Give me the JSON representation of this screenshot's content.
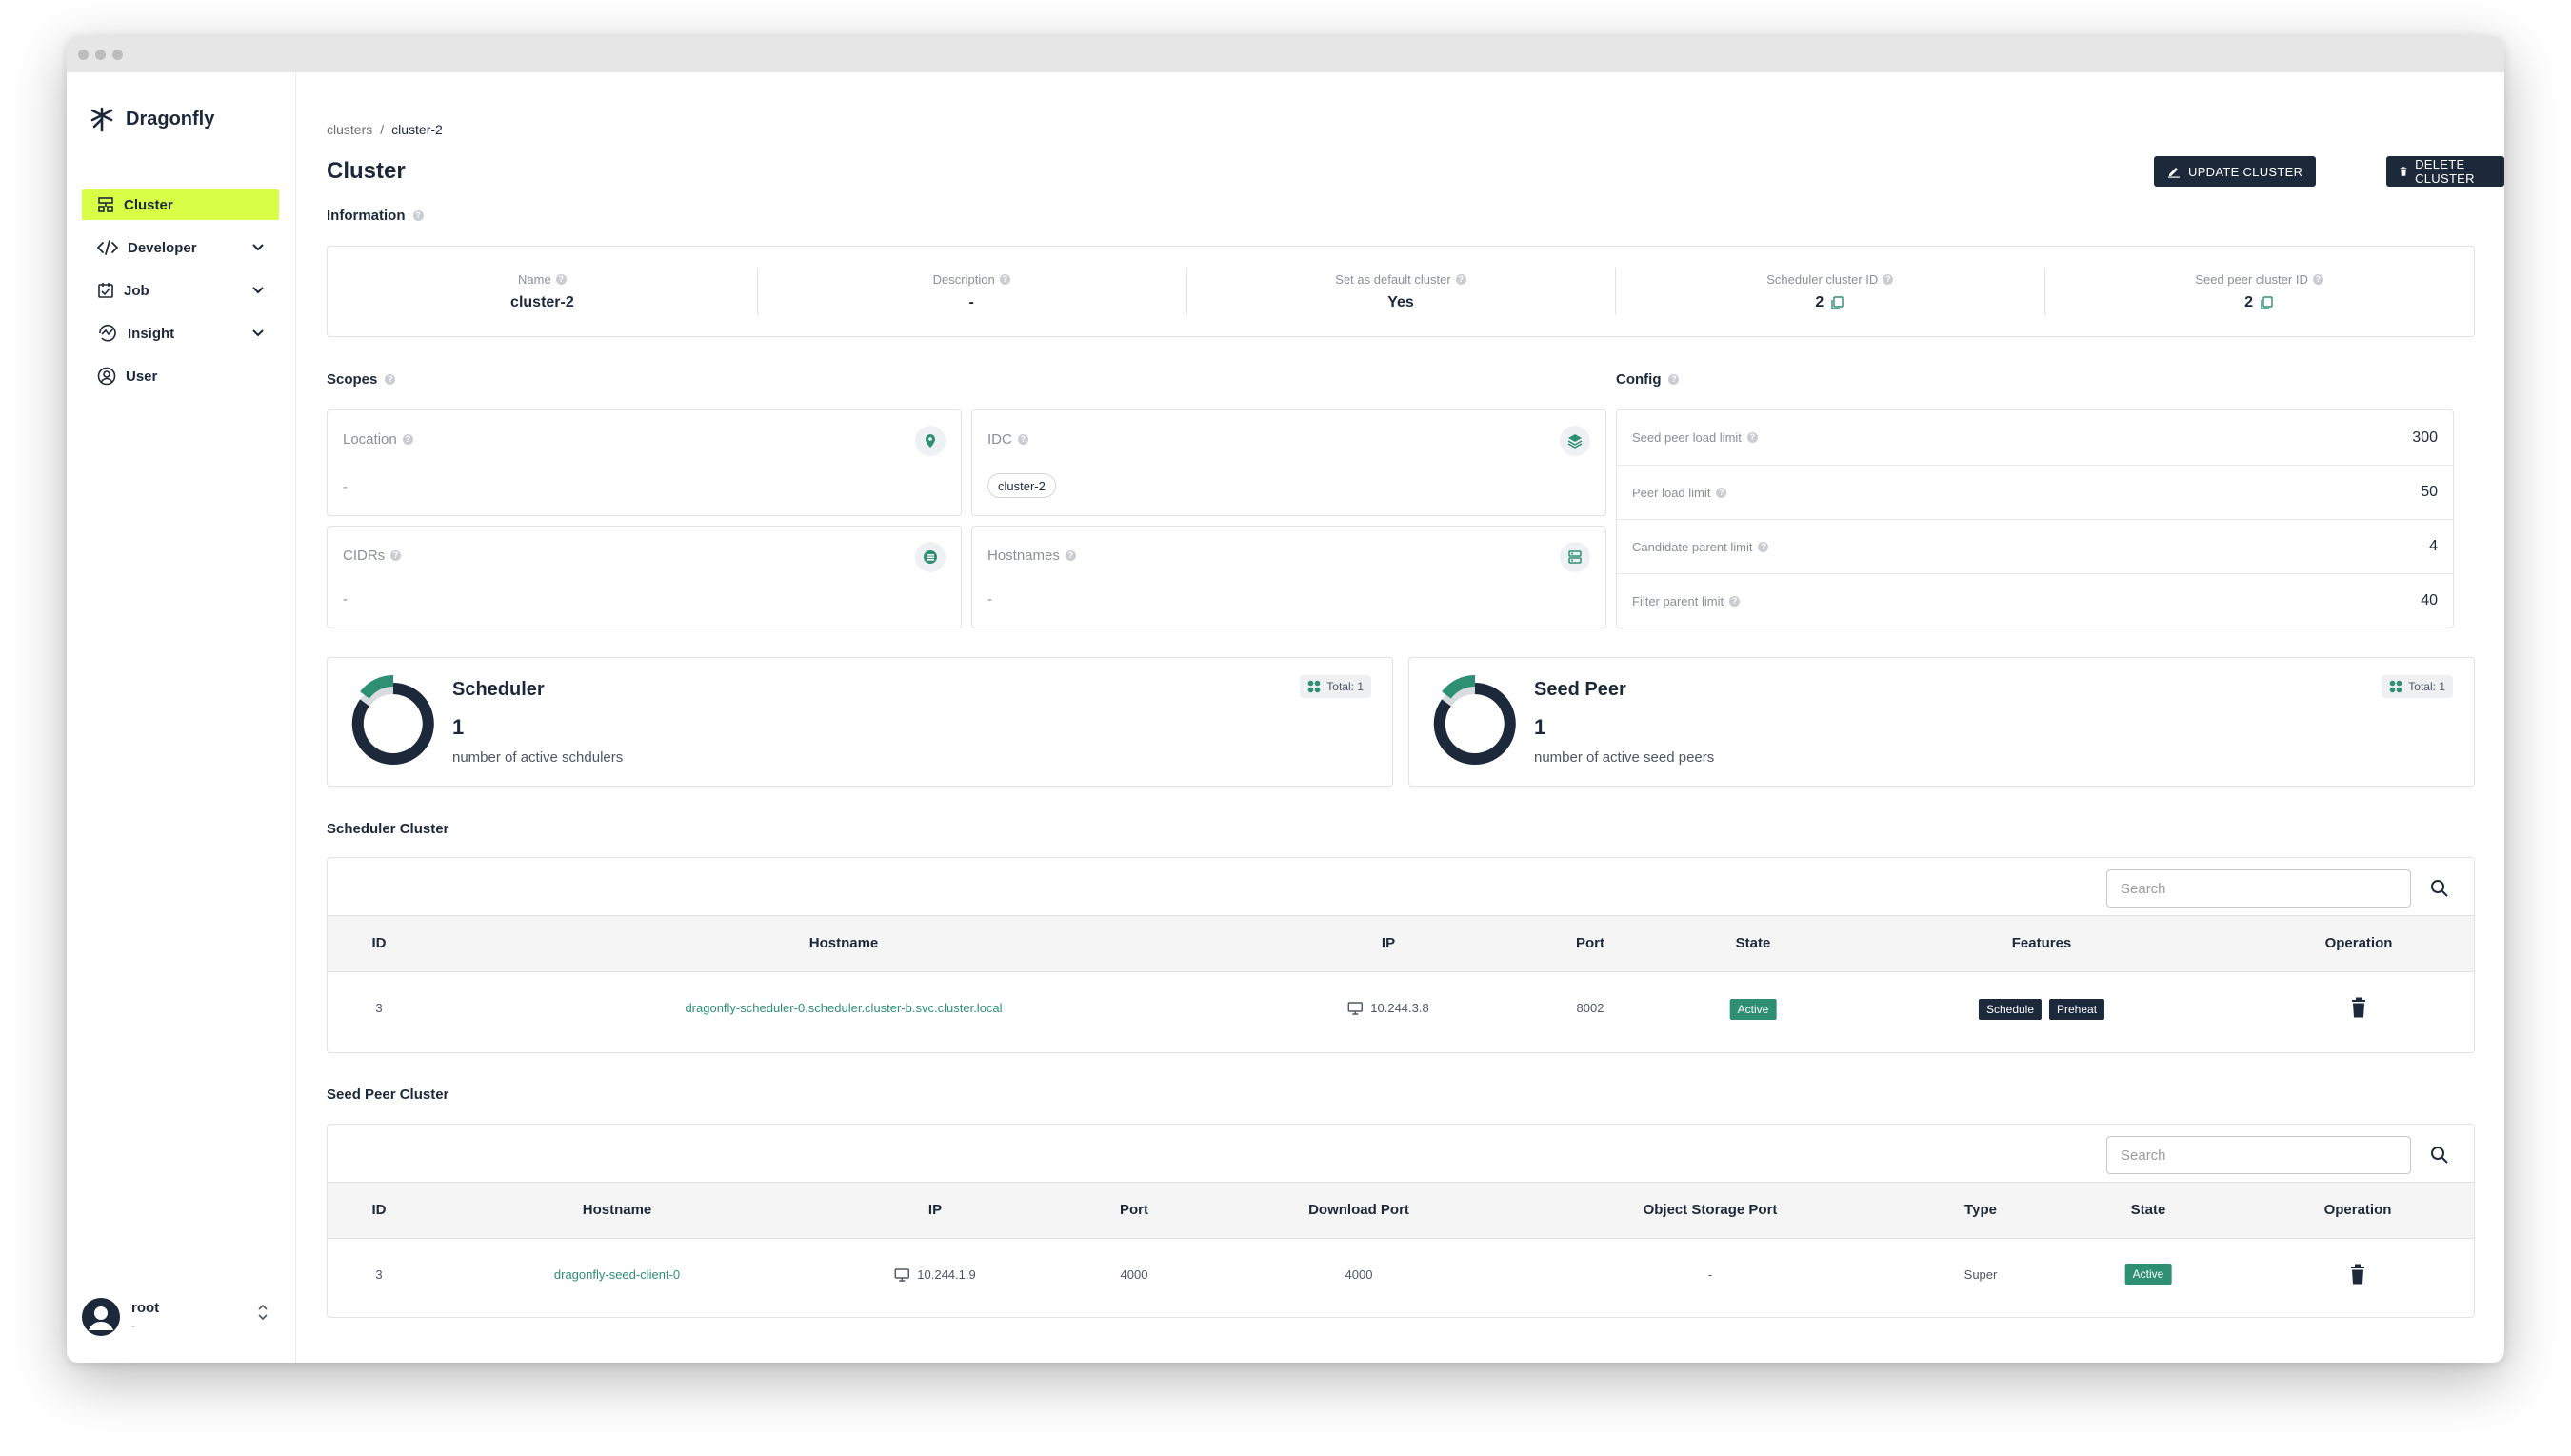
{
  "app": {
    "name": "Dragonfly"
  },
  "sidebar": {
    "items": [
      {
        "label": "Cluster",
        "icon": "cluster-icon",
        "active": true
      },
      {
        "label": "Developer",
        "icon": "code-icon",
        "expandable": true
      },
      {
        "label": "Job",
        "icon": "job-icon",
        "expandable": true
      },
      {
        "label": "Insight",
        "icon": "insight-icon",
        "expandable": true
      },
      {
        "label": "User",
        "icon": "user-icon"
      }
    ],
    "user": {
      "name": "root",
      "sub": "-"
    }
  },
  "breadcrumb": {
    "parent": "clusters",
    "separator": "/",
    "current": "cluster-2"
  },
  "header": {
    "title": "Cluster",
    "update_label": "UPDATE CLUSTER",
    "delete_label": "DELETE CLUSTER"
  },
  "information": {
    "label": "Information",
    "fields": [
      {
        "label": "Name",
        "value": "cluster-2"
      },
      {
        "label": "Description",
        "value": "-"
      },
      {
        "label": "Set as default cluster",
        "value": "Yes"
      },
      {
        "label": "Scheduler cluster ID",
        "value": "2"
      },
      {
        "label": "Seed peer cluster ID",
        "value": "2"
      }
    ]
  },
  "scopes": {
    "label": "Scopes",
    "location": {
      "label": "Location",
      "value": "-"
    },
    "idc": {
      "label": "IDC",
      "chip": "cluster-2"
    },
    "cidrs": {
      "label": "CIDRs",
      "value": "-"
    },
    "hostnames": {
      "label": "Hostnames",
      "value": "-"
    }
  },
  "config": {
    "label": "Config",
    "rows": [
      {
        "label": "Seed peer load limit",
        "value": "300"
      },
      {
        "label": "Peer load limit",
        "value": "50"
      },
      {
        "label": "Candidate parent limit",
        "value": "4"
      },
      {
        "label": "Filter parent limit",
        "value": "40"
      }
    ]
  },
  "stats": {
    "scheduler": {
      "title": "Scheduler",
      "count": "1",
      "sub": "number of active schdulers",
      "total": "Total: 1"
    },
    "seed_peer": {
      "title": "Seed Peer",
      "count": "1",
      "sub": "number of active seed peers",
      "total": "Total: 1"
    }
  },
  "scheduler_cluster": {
    "label": "Scheduler Cluster",
    "search_placeholder": "Search",
    "columns": [
      "ID",
      "Hostname",
      "IP",
      "Port",
      "State",
      "Features",
      "Operation"
    ],
    "rows": [
      {
        "id": "3",
        "hostname": "dragonfly-scheduler-0.scheduler.cluster-b.svc.cluster.local",
        "ip": "10.244.3.8",
        "port": "8002",
        "state": "Active",
        "features": [
          "Schedule",
          "Preheat"
        ]
      }
    ]
  },
  "seed_peer_cluster": {
    "label": "Seed Peer Cluster",
    "search_placeholder": "Search",
    "columns": [
      "ID",
      "Hostname",
      "IP",
      "Port",
      "Download Port",
      "Object Storage Port",
      "Type",
      "State",
      "Operation"
    ],
    "rows": [
      {
        "id": "3",
        "hostname": "dragonfly-seed-client-0",
        "ip": "10.244.1.9",
        "port": "4000",
        "download_port": "4000",
        "object_storage_port": "-",
        "type": "Super",
        "state": "Active"
      }
    ]
  },
  "colors": {
    "accent": "#d8ff45",
    "dark": "#1c293a",
    "green": "#2e8f73"
  }
}
